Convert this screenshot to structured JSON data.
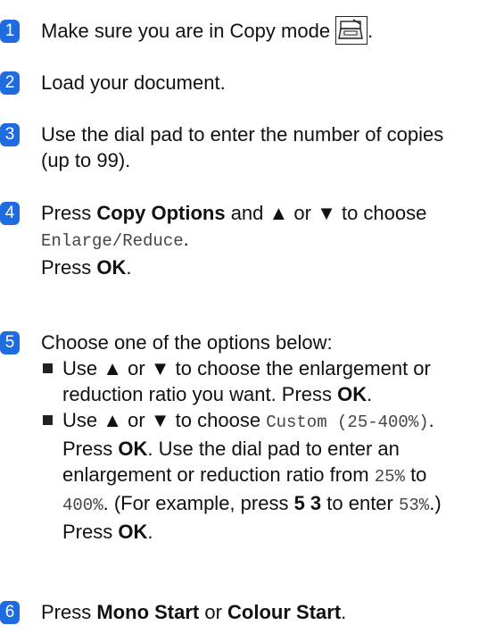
{
  "steps": [
    {
      "number": "1",
      "text_before_icon": "Make sure you are in Copy mode",
      "icon": "copy-mode-icon",
      "text_after_icon": "."
    },
    {
      "number": "2",
      "text": "Load your document."
    },
    {
      "number": "3",
      "text": "Use the dial pad to enter the number of copies (up to 99)."
    },
    {
      "number": "4",
      "t1": "Press ",
      "b1": "Copy Options",
      "t2": " and ▲ or ▼ to choose ",
      "m1": "Enlarge/Reduce",
      "t3": ".",
      "t4": "Press ",
      "b2": "OK",
      "t5": "."
    },
    {
      "number": "5",
      "intro": "Choose one of the options below:",
      "bullets": [
        {
          "t1": "Use ▲ or ▼ to choose the enlargement or reduction ratio you want. Press ",
          "b1": "OK",
          "t2": "."
        },
        {
          "t1": "Use ▲ or ▼ to choose ",
          "m1": "Custom (25-400%)",
          "t2": ". Press ",
          "b1": "OK",
          "t3": ". Use the dial pad to enter an enlargement or reduction ratio from ",
          "m2": "25%",
          "t4": " to ",
          "m3": "400%",
          "t5": ". (For example, press ",
          "b2": "5 3",
          "t6": " to enter ",
          "m4": "53%",
          "t7": ".) Press ",
          "b3": "OK",
          "t8": "."
        }
      ]
    },
    {
      "number": "6",
      "t1": "Press ",
      "b1": "Mono Start",
      "t2": " or ",
      "b2": "Colour Start",
      "t3": "."
    }
  ],
  "colors": {
    "step_badge": "#1f6be0",
    "text": "#111111",
    "mono_text": "#444444"
  }
}
